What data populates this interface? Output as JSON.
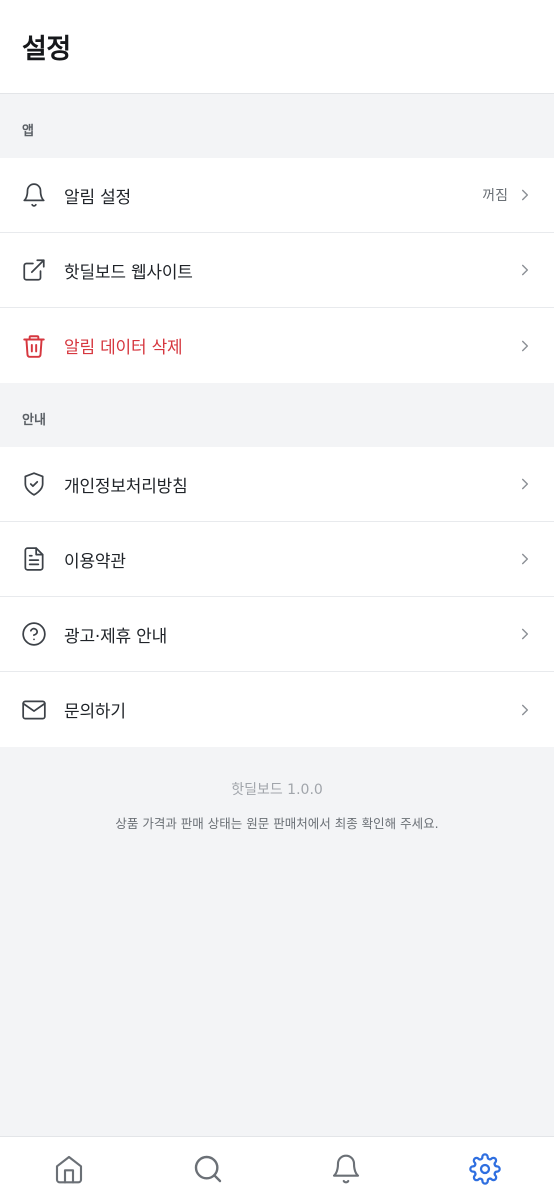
{
  "header": {
    "title": "설정"
  },
  "sections": [
    {
      "label": "앱",
      "items": [
        {
          "label": "알림 설정",
          "value": "꺼짐",
          "icon": "bell-icon"
        },
        {
          "label": "핫딜보드 웹사이트",
          "icon": "external-link-icon"
        },
        {
          "label": "알림 데이터 삭제",
          "icon": "trash-icon",
          "danger": true
        }
      ]
    },
    {
      "label": "안내",
      "items": [
        {
          "label": "개인정보처리방침",
          "icon": "shield-check-icon"
        },
        {
          "label": "이용약관",
          "icon": "document-icon"
        },
        {
          "label": "광고·제휴 안내",
          "icon": "help-circle-icon"
        },
        {
          "label": "문의하기",
          "icon": "mail-icon"
        }
      ]
    }
  ],
  "footer": {
    "version": "핫딜보드 1.0.0",
    "notice": "상품 가격과 판매 상태는 원문 판매처에서 최종 확인해 주세요."
  },
  "tabbar": {
    "tabs": [
      {
        "label": "",
        "icon": "home-icon"
      },
      {
        "label": "",
        "icon": "search-icon"
      },
      {
        "label": "",
        "icon": "bell-icon"
      },
      {
        "label": "",
        "icon": "gear-icon",
        "active": true
      }
    ]
  },
  "colors": {
    "accent": "#2f6fe0",
    "danger": "#d6373f",
    "background": "#f3f4f6",
    "surface": "#ffffff"
  }
}
